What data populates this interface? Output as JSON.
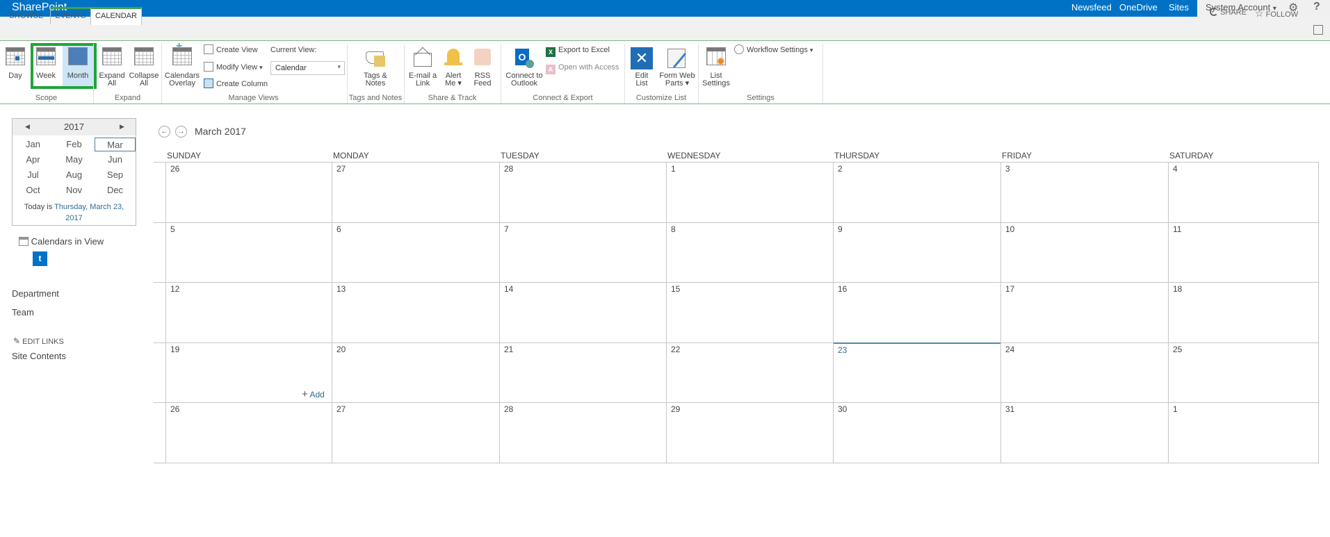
{
  "suite": {
    "brand": "SharePoint",
    "links": [
      "Newsfeed",
      "OneDrive",
      "Sites"
    ],
    "account": "System Account",
    "account_caret": "▾",
    "gear_icon": "⚙",
    "help_icon": "?"
  },
  "tabs": {
    "browse": "BROWSE",
    "events": "EVENTS",
    "calendar": "CALENDAR",
    "share": "SHARE",
    "follow": "FOLLOW"
  },
  "ribbon": {
    "scope": {
      "label": "Scope",
      "day": "Day",
      "week": "Week",
      "month": "Month",
      "selected": "Month"
    },
    "expand": {
      "label": "Expand",
      "expand_all": [
        "Expand",
        "All"
      ],
      "collapse_all": [
        "Collapse",
        "All"
      ]
    },
    "manage_views": {
      "label": "Manage Views",
      "calendars_overlay": [
        "Calendars",
        "Overlay"
      ],
      "create_view": "Create View",
      "modify_view": "Modify View",
      "create_column": "Create Column",
      "current_view_label": "Current View:",
      "current_view_value": "Calendar"
    },
    "tags": {
      "label": "Tags and Notes",
      "tags_notes": [
        "Tags &",
        "Notes"
      ]
    },
    "share_track": {
      "label": "Share & Track",
      "email": [
        "E-mail a",
        "Link"
      ],
      "alert": [
        "Alert",
        "Me ▾"
      ],
      "rss": [
        "RSS",
        "Feed"
      ]
    },
    "connect_export": {
      "label": "Connect & Export",
      "outlook": [
        "Connect to",
        "Outlook"
      ],
      "excel": "Export to Excel",
      "access": "Open with Access"
    },
    "customize": {
      "label": "Customize List",
      "edit_list": [
        "Edit",
        "List"
      ],
      "form_web_parts": [
        "Form Web",
        "Parts ▾"
      ]
    },
    "settings": {
      "label": "Settings",
      "list_settings": [
        "List",
        "Settings"
      ],
      "workflow": "Workflow Settings"
    }
  },
  "minical": {
    "year": "2017",
    "prev_icon": "◀",
    "next_icon": "▶",
    "months": [
      "Jan",
      "Feb",
      "Mar",
      "Apr",
      "May",
      "Jun",
      "Jul",
      "Aug",
      "Sep",
      "Oct",
      "Nov",
      "Dec"
    ],
    "selected_month": "Mar",
    "today_prefix": "Today is ",
    "today_link": "Thursday, March 23,",
    "today_year": "2017"
  },
  "left_nav": {
    "calendars_in_view": "Calendars in View",
    "calendar_badge": "t",
    "links": [
      "Department",
      "Team"
    ],
    "edit_links": "EDIT LINKS",
    "site_contents": "Site Contents"
  },
  "calendar": {
    "title": "March 2017",
    "prev_icon": "←",
    "next_icon": "→",
    "day_headers": [
      "SUNDAY",
      "MONDAY",
      "TUESDAY",
      "WEDNESDAY",
      "THURSDAY",
      "FRIDAY",
      "SATURDAY"
    ],
    "weeks": [
      [
        "26",
        "27",
        "28",
        "1",
        "2",
        "3",
        "4"
      ],
      [
        "5",
        "6",
        "7",
        "8",
        "9",
        "10",
        "11"
      ],
      [
        "12",
        "13",
        "14",
        "15",
        "16",
        "17",
        "18"
      ],
      [
        "19",
        "20",
        "21",
        "22",
        "23",
        "24",
        "25"
      ],
      [
        "26",
        "27",
        "28",
        "29",
        "30",
        "31",
        "1"
      ]
    ],
    "today": "23",
    "add_label": "Add",
    "add_icon": "+"
  }
}
